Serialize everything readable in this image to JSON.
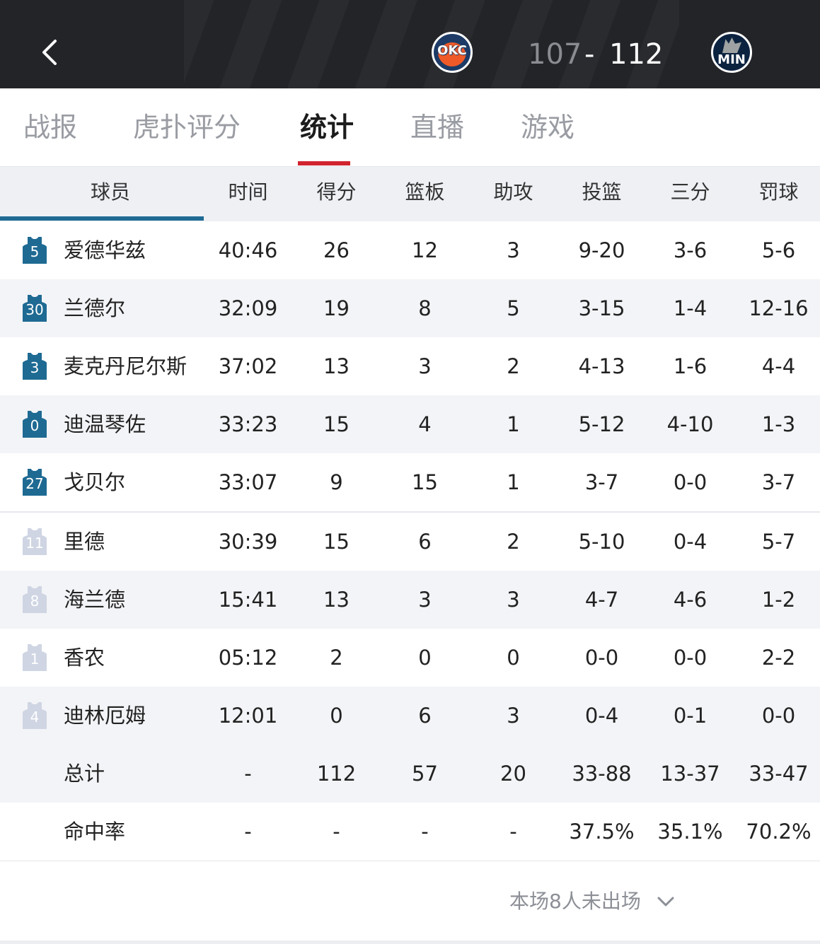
{
  "header": {
    "home_team": "OKC",
    "away_team": "MIN",
    "home_score": "107",
    "separator": "-",
    "away_score": "112",
    "colors": {
      "header_bg": "#232428",
      "okc_navy": "#1d3b66",
      "okc_orange": "#f05a28",
      "min_navy": "#0c2340"
    }
  },
  "tabs": [
    {
      "label": "战报",
      "active": false
    },
    {
      "label": "虎扑评分",
      "active": false
    },
    {
      "label": "统计",
      "active": true
    },
    {
      "label": "直播",
      "active": false
    },
    {
      "label": "游戏",
      "active": false
    }
  ],
  "table": {
    "headers": [
      "球员",
      "时间",
      "得分",
      "篮板",
      "助攻",
      "投篮",
      "三分",
      "罚球"
    ],
    "starters": [
      {
        "number": "5",
        "name": "爱德华兹",
        "time": "40:46",
        "pts": "26",
        "reb": "12",
        "ast": "3",
        "fg": "9-20",
        "tp": "3-6",
        "ft": "5-6"
      },
      {
        "number": "30",
        "name": "兰德尔",
        "time": "32:09",
        "pts": "19",
        "reb": "8",
        "ast": "5",
        "fg": "3-15",
        "tp": "1-4",
        "ft": "12-16"
      },
      {
        "number": "3",
        "name": "麦克丹尼尔斯",
        "time": "37:02",
        "pts": "13",
        "reb": "3",
        "ast": "2",
        "fg": "4-13",
        "tp": "1-6",
        "ft": "4-4"
      },
      {
        "number": "0",
        "name": "迪温琴佐",
        "time": "33:23",
        "pts": "15",
        "reb": "4",
        "ast": "1",
        "fg": "5-12",
        "tp": "4-10",
        "ft": "1-3"
      },
      {
        "number": "27",
        "name": "戈贝尔",
        "time": "33:07",
        "pts": "9",
        "reb": "15",
        "ast": "1",
        "fg": "3-7",
        "tp": "0-0",
        "ft": "3-7"
      }
    ],
    "bench": [
      {
        "number": "11",
        "name": "里德",
        "time": "30:39",
        "pts": "15",
        "reb": "6",
        "ast": "2",
        "fg": "5-10",
        "tp": "0-4",
        "ft": "5-7"
      },
      {
        "number": "8",
        "name": "海兰德",
        "time": "15:41",
        "pts": "13",
        "reb": "3",
        "ast": "3",
        "fg": "4-7",
        "tp": "4-6",
        "ft": "1-2"
      },
      {
        "number": "1",
        "name": "香农",
        "time": "05:12",
        "pts": "2",
        "reb": "0",
        "ast": "0",
        "fg": "0-0",
        "tp": "0-0",
        "ft": "2-2"
      },
      {
        "number": "4",
        "name": "迪林厄姆",
        "time": "12:01",
        "pts": "0",
        "reb": "6",
        "ast": "3",
        "fg": "0-4",
        "tp": "0-1",
        "ft": "0-0"
      }
    ],
    "totals": {
      "name": "总计",
      "time": "-",
      "pts": "112",
      "reb": "57",
      "ast": "20",
      "fg": "33-88",
      "tp": "13-37",
      "ft": "33-47"
    },
    "pct": {
      "name": "命中率",
      "time": "-",
      "pts": "-",
      "reb": "-",
      "ast": "-",
      "fg": "37.5%",
      "tp": "35.1%",
      "ft": "70.2%"
    },
    "colors": {
      "starter_jersey": "#1e6a93",
      "bench_jersey": "#cfd5e3",
      "active_tab": "#d0242f"
    }
  },
  "footer": {
    "dnp_label": "本场8人未出场"
  }
}
